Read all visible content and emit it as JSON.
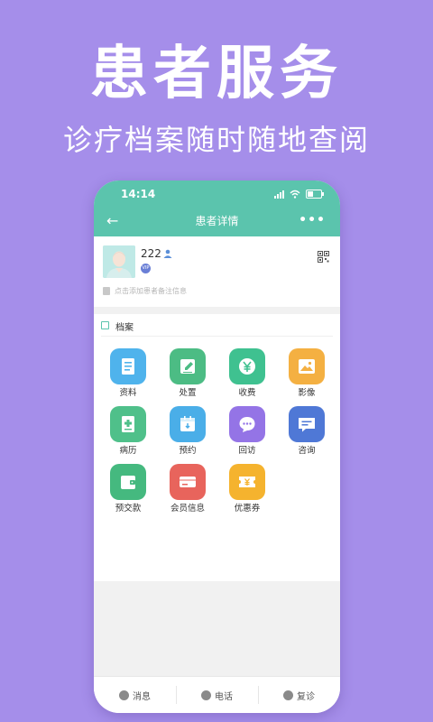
{
  "promo": {
    "title": "患者服务",
    "subtitle": "诊疗档案随时随地查阅"
  },
  "status_bar": {
    "time": "14:14"
  },
  "nav": {
    "title": "患者详情",
    "back_icon": "back-arrow-icon",
    "more_label": "•••"
  },
  "patient": {
    "name": "222",
    "vip_badge": "VIP",
    "note_placeholder": "点击添加患者备注信息"
  },
  "archive": {
    "title": "档案",
    "items": [
      {
        "label": "资料",
        "icon": "document-icon",
        "color": "#4fb3ec"
      },
      {
        "label": "处置",
        "icon": "edit-icon",
        "color": "#4cbc84"
      },
      {
        "label": "收费",
        "icon": "yen-coin-icon",
        "color": "#3fc190"
      },
      {
        "label": "影像",
        "icon": "image-icon",
        "color": "#f4b042"
      },
      {
        "label": "病历",
        "icon": "medical-record-icon",
        "color": "#4fc08a"
      },
      {
        "label": "预约",
        "icon": "calendar-icon",
        "color": "#4aaee8"
      },
      {
        "label": "回访",
        "icon": "chat-bubble-icon",
        "color": "#9474e6"
      },
      {
        "label": "咨询",
        "icon": "message-icon",
        "color": "#4f78d6"
      },
      {
        "label": "预交款",
        "icon": "wallet-icon",
        "color": "#45b97f"
      },
      {
        "label": "会员信息",
        "icon": "card-icon",
        "color": "#e8645c"
      },
      {
        "label": "优惠券",
        "icon": "coupon-icon",
        "color": "#f5b32e"
      }
    ]
  },
  "bottom_actions": [
    {
      "label": "消息",
      "icon": "message-icon"
    },
    {
      "label": "电话",
      "icon": "phone-icon"
    },
    {
      "label": "复诊",
      "icon": "revisit-icon"
    }
  ]
}
